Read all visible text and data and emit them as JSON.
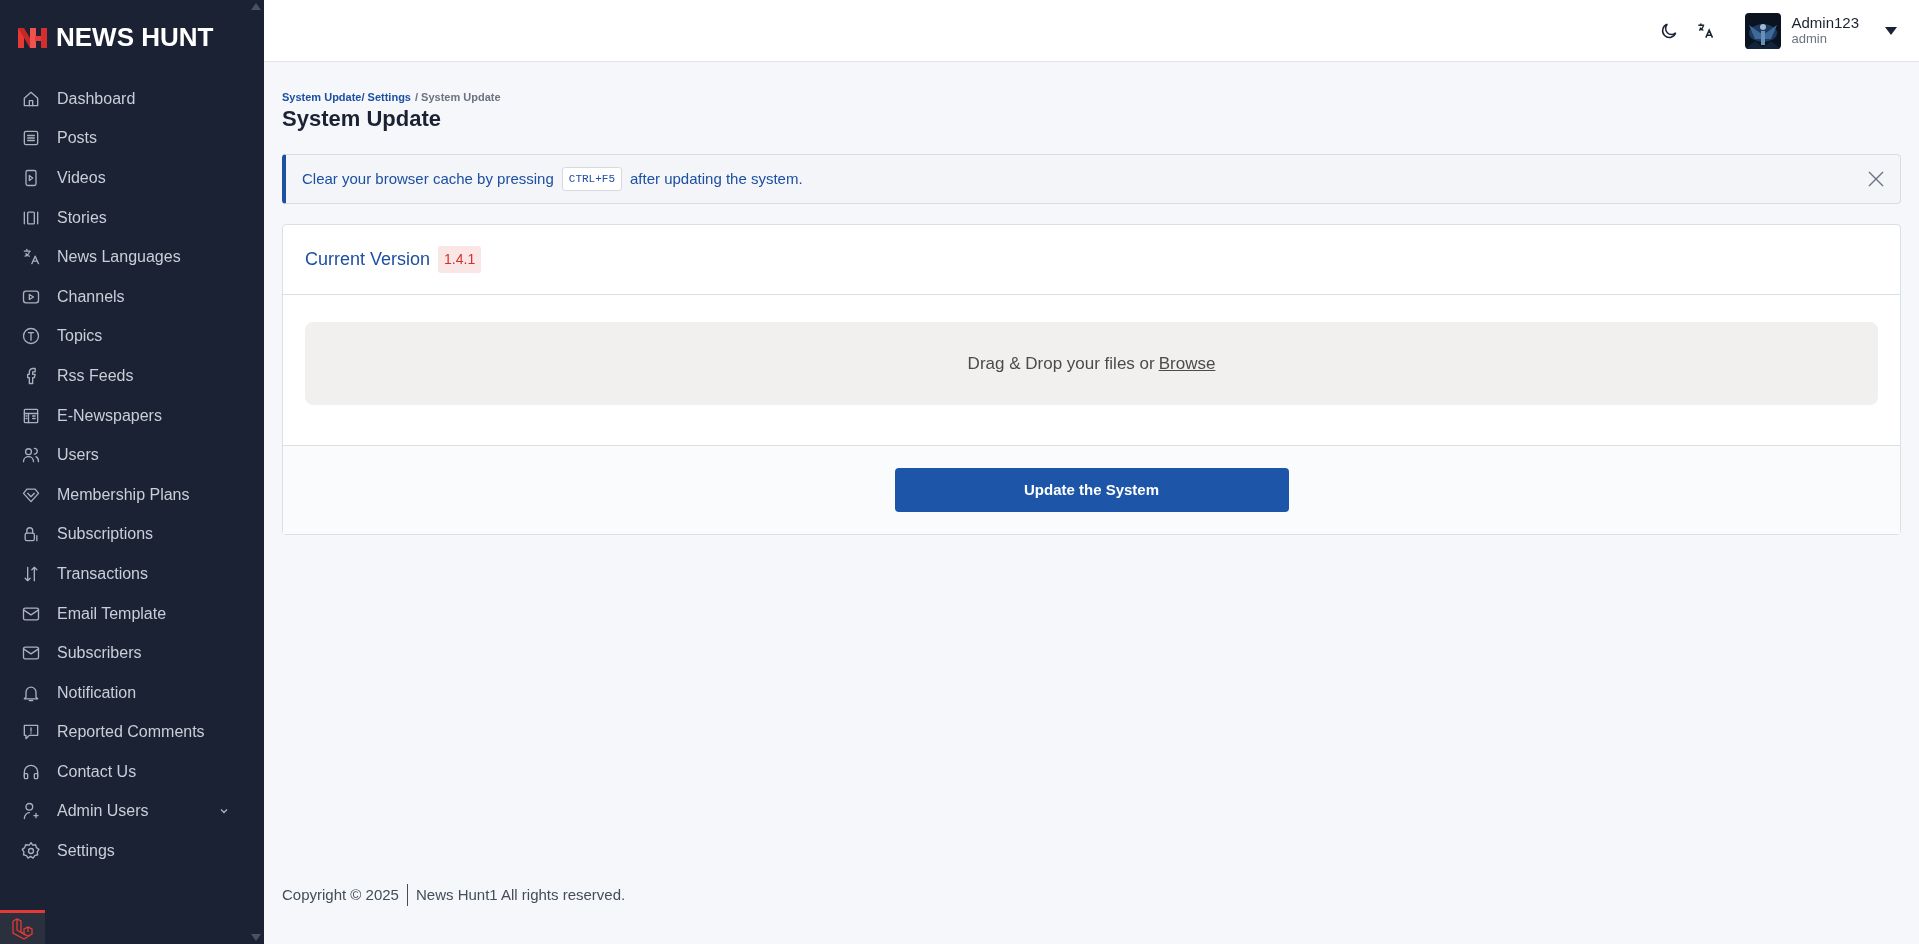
{
  "sidebar": {
    "brand": "NEWS HUNT",
    "items": [
      {
        "label": "Dashboard"
      },
      {
        "label": "Posts"
      },
      {
        "label": "Videos"
      },
      {
        "label": "Stories"
      },
      {
        "label": "News Languages"
      },
      {
        "label": "Channels"
      },
      {
        "label": "Topics"
      },
      {
        "label": "Rss Feeds"
      },
      {
        "label": "E-Newspapers"
      },
      {
        "label": "Users"
      },
      {
        "label": "Membership Plans"
      },
      {
        "label": "Subscriptions"
      },
      {
        "label": "Transactions"
      },
      {
        "label": "Email Template"
      },
      {
        "label": "Subscribers"
      },
      {
        "label": "Notification"
      },
      {
        "label": "Reported Comments"
      },
      {
        "label": "Contact Us"
      },
      {
        "label": "Admin Users",
        "has_submenu": true
      },
      {
        "label": "Settings"
      }
    ]
  },
  "header": {
    "user": {
      "name": "Admin123",
      "role": "admin"
    }
  },
  "breadcrumb": [
    {
      "label": "System Update/ Settings",
      "link": true
    },
    {
      "label": "/ System Update",
      "link": false
    }
  ],
  "page_title": "System Update",
  "alert": {
    "before": "Clear your browser cache by pressing",
    "key": "CTRL+F5",
    "after": "after updating the system."
  },
  "card": {
    "title": "Current Version",
    "version": "1.4.1",
    "dropzone": {
      "text": "Drag & Drop your files or",
      "link": "Browse"
    },
    "button": "Update the System"
  },
  "footer": {
    "copyright": "Copyright © 2025",
    "text": "News Hunt1 All rights reserved."
  }
}
